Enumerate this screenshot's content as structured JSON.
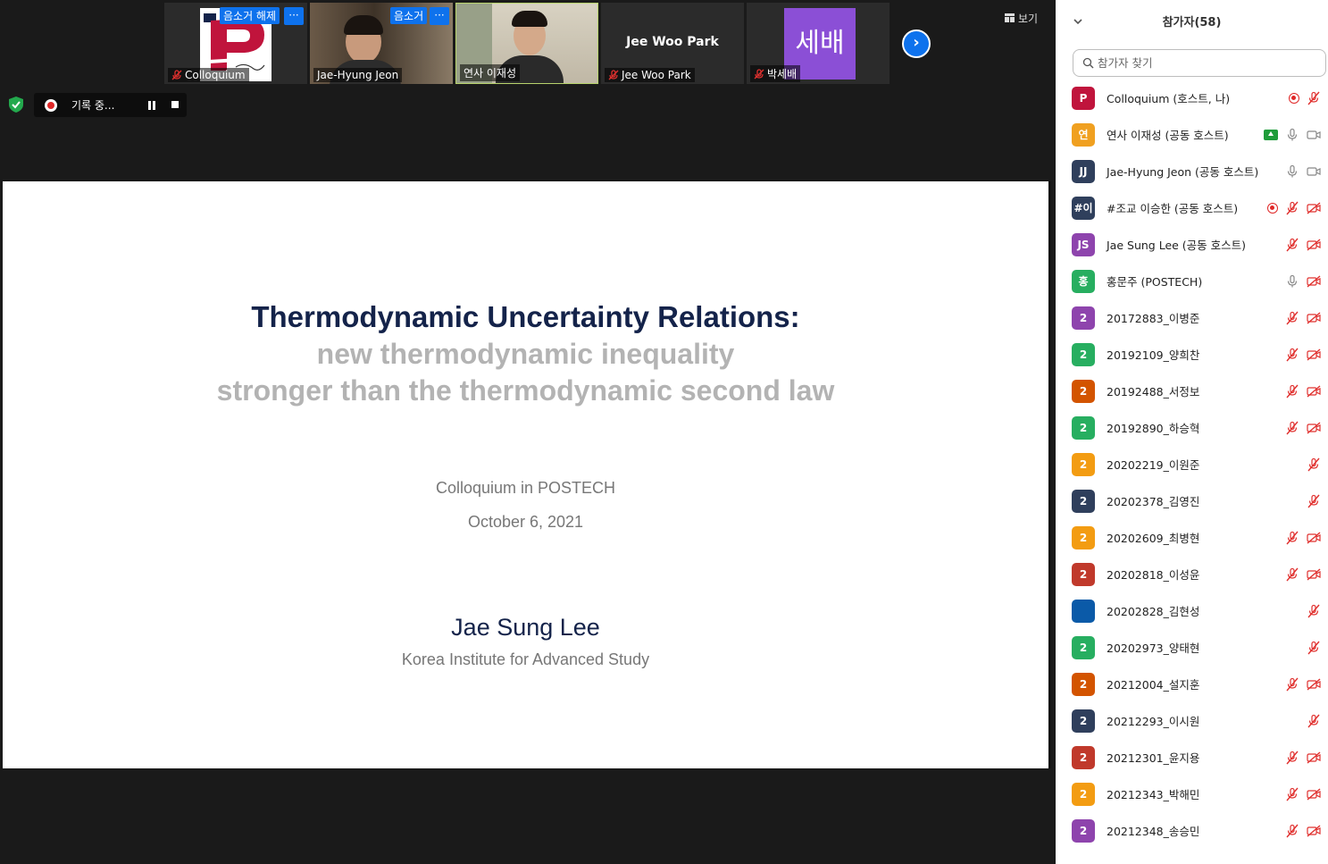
{
  "gallery": {
    "tiles": [
      {
        "name": "Colloquium",
        "badge": "음소거 해제",
        "type": "logo",
        "muted": true
      },
      {
        "name": "Jae-Hyung Jeon",
        "badge": "음소거",
        "type": "video",
        "muted": false
      },
      {
        "name": "연사 이재성",
        "badge": "",
        "type": "video",
        "muted": false
      },
      {
        "name": "Jee Woo Park",
        "center": "Jee Woo Park",
        "type": "name",
        "muted": true
      },
      {
        "name": "박세배",
        "avatar": "세배",
        "type": "avatar",
        "muted": true
      }
    ],
    "more_label": "···",
    "view_label": "보기",
    "next_icon": "chevron-right-icon"
  },
  "recording": {
    "label": "기록 중..."
  },
  "slide": {
    "title": "Thermodynamic Uncertainty Relations:",
    "subtitle1": "new thermodynamic inequality",
    "subtitle2": "stronger than the thermodynamic second law",
    "event": "Colloquium in POSTECH",
    "date": "October 6, 2021",
    "author": "Jae Sung Lee",
    "affiliation": "Korea Institute for Advanced Study"
  },
  "panel": {
    "title": "참가자(58)",
    "search_placeholder": "참가자 찾기",
    "participants": [
      {
        "avatar": "P",
        "color": "#c0143c",
        "name": "Colloquium (호스트, 나)",
        "icons": [
          "rec",
          "mic-off"
        ]
      },
      {
        "avatar": "연",
        "color": "#f0a020",
        "name": "연사 이재성 (공동 호스트)",
        "icons": [
          "share",
          "mic",
          "cam"
        ]
      },
      {
        "avatar": "JJ",
        "color": "#2f3f5c",
        "name": "Jae-Hyung Jeon (공동 호스트)",
        "icons": [
          "mic",
          "cam"
        ]
      },
      {
        "avatar": "#이",
        "color": "#2f3f5c",
        "name": "#조교 이승한 (공동 호스트)",
        "icons": [
          "rec",
          "mic-off",
          "cam-off"
        ]
      },
      {
        "avatar": "JS",
        "color": "#8e44ad",
        "name": "Jae Sung Lee (공동 호스트)",
        "icons": [
          "mic-off",
          "cam-off"
        ]
      },
      {
        "avatar": "홍",
        "color": "#27ae60",
        "name": "홍문주 (POSTECH)",
        "icons": [
          "mic",
          "cam-off"
        ]
      },
      {
        "avatar": "2",
        "color": "#8e44ad",
        "name": "20172883_이병준",
        "icons": [
          "mic-off",
          "cam-off"
        ]
      },
      {
        "avatar": "2",
        "color": "#27ae60",
        "name": "20192109_양희찬",
        "icons": [
          "mic-off",
          "cam-off"
        ]
      },
      {
        "avatar": "2",
        "color": "#d35400",
        "name": "20192488_서정보",
        "icons": [
          "mic-off",
          "cam-off"
        ]
      },
      {
        "avatar": "2",
        "color": "#27ae60",
        "name": "20192890_하승혁",
        "icons": [
          "mic-off",
          "cam-off"
        ]
      },
      {
        "avatar": "2",
        "color": "#f39c12",
        "name": "20202219_이원준",
        "icons": [
          "mic-off"
        ]
      },
      {
        "avatar": "2",
        "color": "#2f3f5c",
        "name": "20202378_김영진",
        "icons": [
          "mic-off"
        ]
      },
      {
        "avatar": "2",
        "color": "#f39c12",
        "name": "20202609_최병현",
        "icons": [
          "mic-off",
          "cam-off"
        ]
      },
      {
        "avatar": "2",
        "color": "#c0392b",
        "name": "20202818_이성윤",
        "icons": [
          "mic-off",
          "cam-off"
        ]
      },
      {
        "avatar": "",
        "color": "#0b5aa8",
        "name": "20202828_김현성",
        "icons": [
          "mic-off"
        ]
      },
      {
        "avatar": "2",
        "color": "#27ae60",
        "name": "20202973_양태현",
        "icons": [
          "mic-off"
        ]
      },
      {
        "avatar": "2",
        "color": "#d35400",
        "name": "20212004_설지훈",
        "icons": [
          "mic-off",
          "cam-off"
        ]
      },
      {
        "avatar": "2",
        "color": "#2f3f5c",
        "name": "20212293_이시원",
        "icons": [
          "mic-off"
        ]
      },
      {
        "avatar": "2",
        "color": "#c0392b",
        "name": "20212301_윤지용",
        "icons": [
          "mic-off",
          "cam-off"
        ]
      },
      {
        "avatar": "2",
        "color": "#f39c12",
        "name": "20212343_박해민",
        "icons": [
          "mic-off",
          "cam-off"
        ]
      },
      {
        "avatar": "2",
        "color": "#8e44ad",
        "name": "20212348_송승민",
        "icons": [
          "mic-off",
          "cam-off"
        ]
      }
    ]
  }
}
